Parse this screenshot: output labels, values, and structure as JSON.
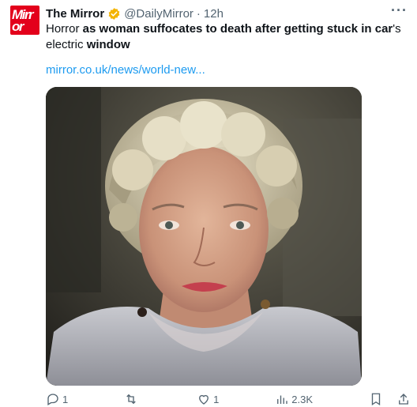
{
  "tweet": {
    "avatar_text_line1": "Mirr",
    "avatar_text_line2": "or",
    "author_name": "The Mirror",
    "handle": "@DailyMirror",
    "separator": "·",
    "time": "12h",
    "text_part1": "Horror ",
    "text_part2": "as woman suffocates to death after getting stuck in car",
    "text_part3": "'s electric ",
    "text_part4": "window",
    "link": "mirror.co.uk/news/world-new...",
    "more_label": "···",
    "verified_badge_color": "#f4b400",
    "link_color": "#1d9bf0"
  },
  "actions": {
    "reply_icon": "reply-icon",
    "reply_count": "1",
    "retweet_icon": "retweet-icon",
    "retweet_count": "",
    "like_icon": "heart-icon",
    "like_count": "1",
    "views_icon": "views-icon",
    "views_count": "2.3K",
    "bookmark_icon": "bookmark-icon",
    "share_icon": "share-icon"
  }
}
